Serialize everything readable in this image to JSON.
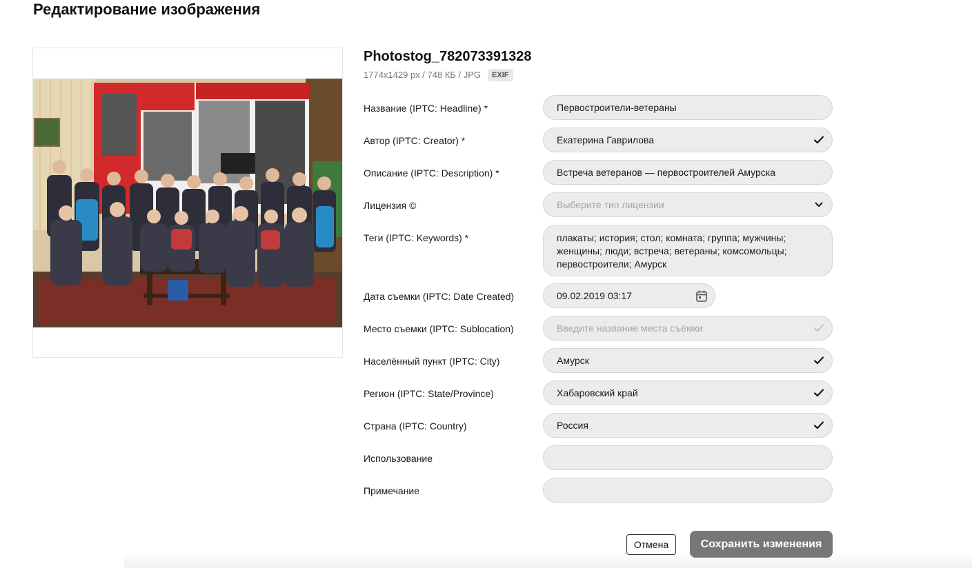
{
  "page": {
    "title": "Редактирование изображения"
  },
  "file": {
    "name": "Photostog_782073391328",
    "meta": "1774x1429 px / 748 КБ / JPG",
    "exif_badge": "EXIF"
  },
  "fields": {
    "headline": {
      "label": "Название (IPTC: Headline) *",
      "value": "Первостроители-ветераны"
    },
    "creator": {
      "label": "Автор (IPTC: Creator) *",
      "value": "Екатерина Гаврилова",
      "icon": "check-icon"
    },
    "description": {
      "label": "Описание (IPTC: Description) *",
      "value": "Встреча ветеранов — первостроителей Амурска"
    },
    "license": {
      "label": "Лицензия ©",
      "placeholder": "Выберите тип лицензии",
      "icon": "chevron-down-icon"
    },
    "keywords": {
      "label": "Теги (IPTC: Keywords) *",
      "value": "плакаты; история; стол; комната; группа; мужчины; женщины; люди; встреча; ветераны; комсомольцы; первостроители; Амурск"
    },
    "date_created": {
      "label": "Дата съемки (IPTC: Date Created)",
      "value": "09.02.2019 03:17",
      "icon": "calendar-icon"
    },
    "sublocation": {
      "label": "Место съемки (IPTC: Sublocation)",
      "placeholder": "Введите название места съёмки",
      "icon": "check-icon"
    },
    "city": {
      "label": "Населённый пункт (IPTC: City)",
      "value": "Амурск",
      "icon": "check-icon"
    },
    "state": {
      "label": "Регион (IPTC: State/Province)",
      "value": "Хабаровский край",
      "icon": "check-icon"
    },
    "country": {
      "label": "Страна (IPTC: Country)",
      "value": "Россия",
      "icon": "check-icon"
    },
    "usage": {
      "label": "Использование",
      "value": ""
    },
    "note": {
      "label": "Примечание",
      "value": ""
    }
  },
  "actions": {
    "cancel_label": "Отмена",
    "save_label": "Сохранить изменения"
  },
  "colors": {
    "field_bg": "#ececec",
    "save_button_bg": "#777777",
    "check_active": "#1a1a1a",
    "check_inactive": "#c4c4c4"
  }
}
